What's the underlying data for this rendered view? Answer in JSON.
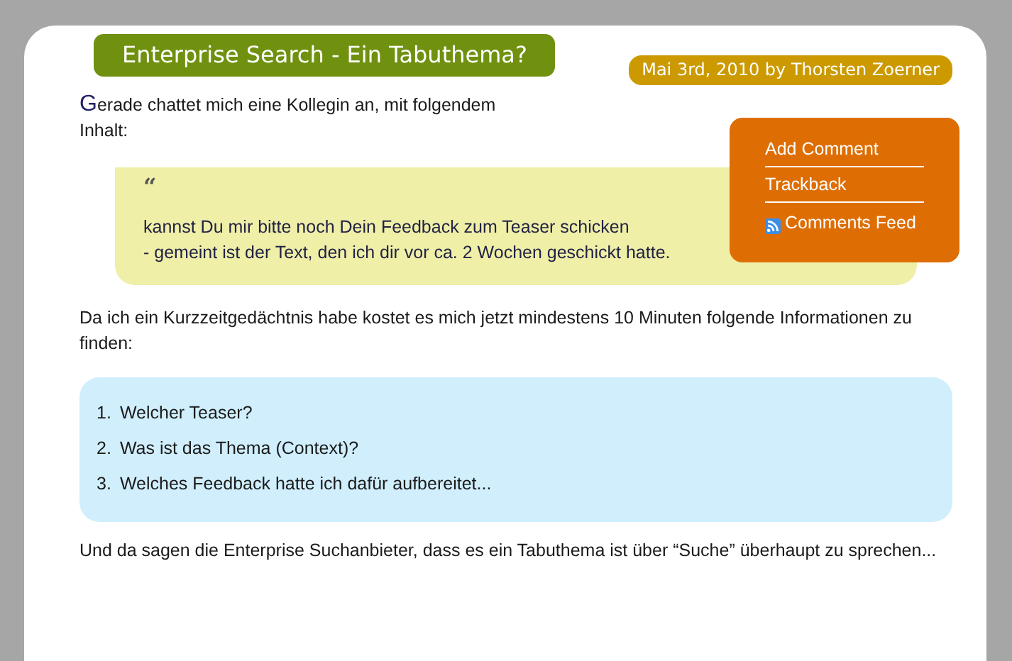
{
  "post": {
    "title": "Enterprise Search - Ein Tabuthema?",
    "meta": "Mai 3rd, 2010 by Thorsten Zoerner",
    "intro": "Gerade chattet mich eine Kollegin an, mit folgendem Inhalt:",
    "quote": {
      "mark": "“",
      "lines": [
        "kannst Du mir bitte noch Dein Feedback zum Teaser schicken",
        "- gemeint ist der Text, den ich dir vor ca. 2 Wochen geschickt hatte."
      ]
    },
    "paragraph": "Da ich ein Kurzzeitgedächtnis habe kostet es mich jetzt mindestens 10 Minuten folgende Informationen zu finden:",
    "list": [
      {
        "number": "1.",
        "text": "Welcher Teaser?"
      },
      {
        "number": "2.",
        "text": "Was ist das Thema (Context)?"
      },
      {
        "number": "3.",
        "text": "Welches Feedback hatte ich dafür aufbereitet..."
      }
    ],
    "closing": "Und da sagen die Enterprise Suchanbieter, dass es ein Tabuthema ist über “Suche” überhaupt zu sprechen..."
  },
  "sidebar": {
    "links": [
      {
        "label": "Add Comment",
        "kind": "plain"
      },
      {
        "label": "Trackback",
        "kind": "plain"
      },
      {
        "label": "Comments Feed",
        "kind": "feed"
      }
    ]
  }
}
